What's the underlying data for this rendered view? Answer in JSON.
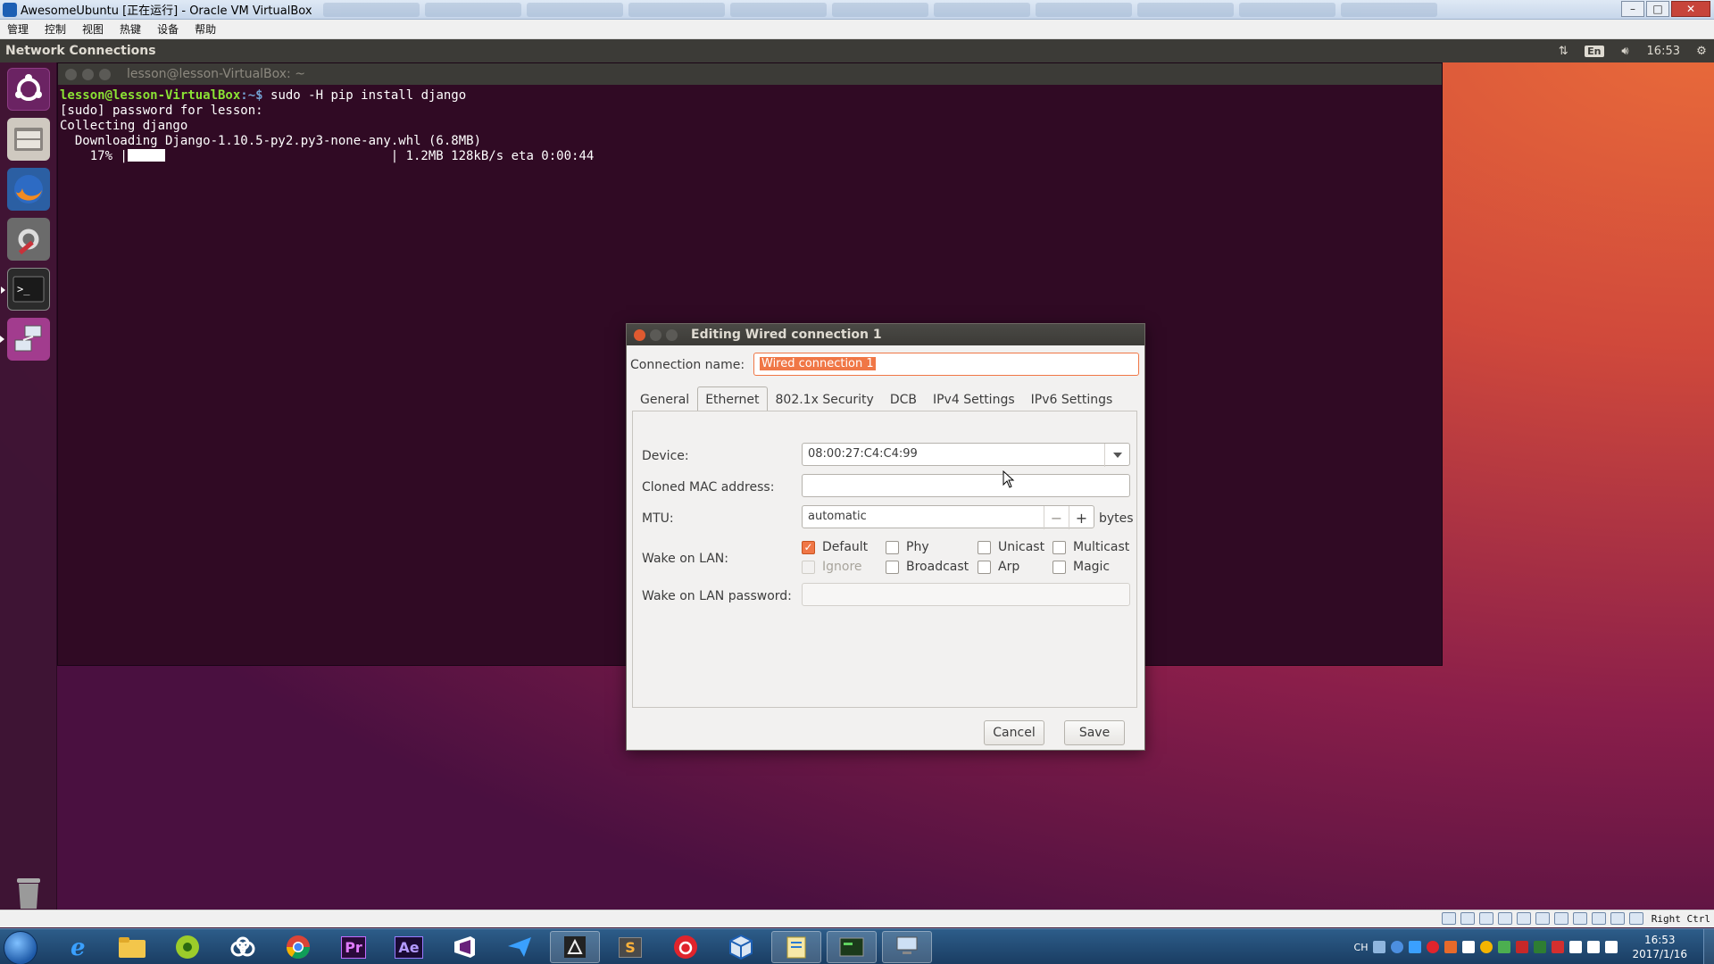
{
  "vbox": {
    "window_title": "AwesomeUbuntu [正在运行] - Oracle VM VirtualBox",
    "menu": [
      "管理",
      "控制",
      "视图",
      "热键",
      "设备",
      "帮助"
    ],
    "host_key": "Right Ctrl"
  },
  "ubuntu_panel": {
    "title": "Network Connections",
    "lang": "En",
    "time": "16:53"
  },
  "launcher": [
    "ubuntu-dash",
    "files",
    "firefox",
    "system-settings",
    "terminal",
    "network-connections",
    "trash"
  ],
  "terminal": {
    "title": "lesson@lesson-VirtualBox: ~",
    "prompt_user": "lesson@lesson-VirtualBox",
    "prompt_path": ":~$",
    "command": " sudo -H pip install django",
    "lines": [
      "[sudo] password for lesson:",
      "Collecting django",
      "  Downloading Django-1.10.5-py2.py3-none-any.whl (6.8MB)"
    ],
    "progress_percent": "    17% |",
    "progress_fraction": 0.17,
    "progress_tail": "                              | 1.2MB 128kB/s eta 0:00:44"
  },
  "dialog": {
    "title": "Editing Wired connection 1",
    "connection_name_label": "Connection name:",
    "connection_name_value": "Wired connection 1",
    "tabs": [
      "General",
      "Ethernet",
      "802.1x Security",
      "DCB",
      "IPv4 Settings",
      "IPv6 Settings"
    ],
    "active_tab": "Ethernet",
    "device_label": "Device:",
    "device_value": "08:00:27:C4:C4:99",
    "cloned_mac_label": "Cloned MAC address:",
    "cloned_mac_value": "",
    "mtu_label": "MTU:",
    "mtu_value": "automatic",
    "mtu_minus": "−",
    "mtu_plus": "+",
    "mtu_unit": "bytes",
    "wol_label": "Wake on LAN:",
    "wol_options": [
      {
        "label": "Default",
        "checked": true,
        "disabled": false
      },
      {
        "label": "Phy",
        "checked": false,
        "disabled": false
      },
      {
        "label": "Unicast",
        "checked": false,
        "disabled": false
      },
      {
        "label": "Multicast",
        "checked": false,
        "disabled": false
      },
      {
        "label": "Ignore",
        "checked": false,
        "disabled": true
      },
      {
        "label": "Broadcast",
        "checked": false,
        "disabled": false
      },
      {
        "label": "Arp",
        "checked": false,
        "disabled": false
      },
      {
        "label": "Magic",
        "checked": false,
        "disabled": false
      }
    ],
    "wol_password_label": "Wake on LAN password:",
    "wol_password_value": "",
    "cancel_label": "Cancel",
    "save_label": "Save"
  },
  "taskbar": {
    "apps": [
      "internet-explorer",
      "windows-explorer",
      "media-player",
      "baidu-netdisk",
      "chrome",
      "Pr",
      "Ae",
      "visual-studio",
      "feishu",
      "unity",
      "S",
      "netease-music",
      "virtualbox",
      "notepad",
      "shell",
      "remote-desktop"
    ],
    "tray_lang": "CH",
    "clock_time": "16:53",
    "clock_date": "2017/1/16"
  },
  "colors": {
    "ubuntu_orange": "#f07746",
    "terminal_bg": "#300a24",
    "prompt_green": "#8ae234",
    "panel_dark": "#3c3b37"
  }
}
